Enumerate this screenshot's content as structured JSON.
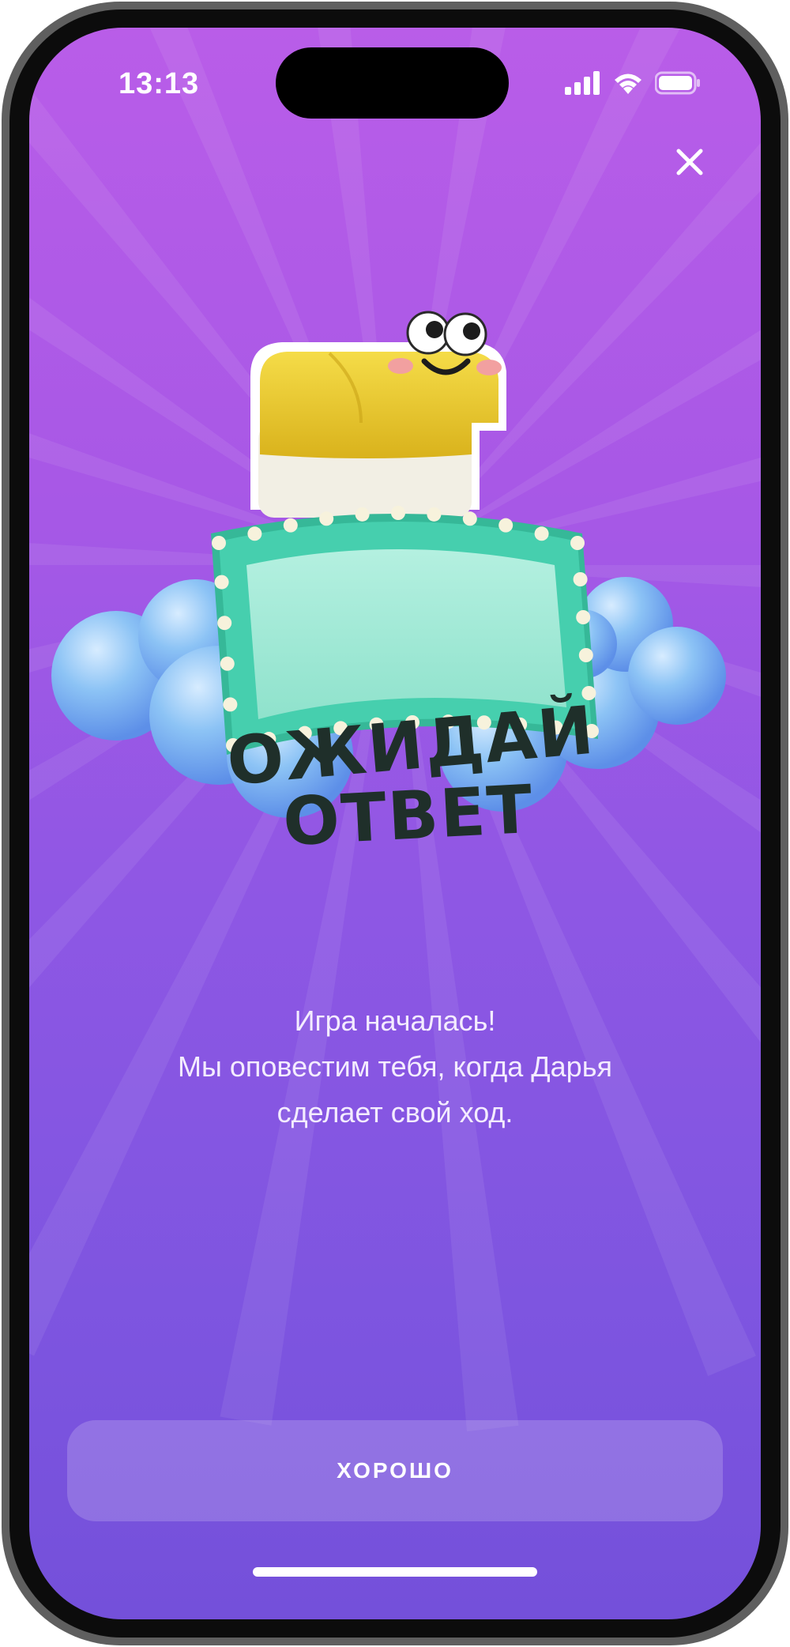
{
  "status_bar": {
    "time": "13:13",
    "icons": [
      "cellular-signal-icon",
      "wifi-icon",
      "battery-icon"
    ]
  },
  "close_icon": "close-icon",
  "illustration": {
    "sign_line1": "ОЖИДАЙ",
    "sign_line2": "ОТВЕТ",
    "mascot_icon": "scroll-mascot-icon"
  },
  "message": {
    "line1": "Игра началась!",
    "line2": "Мы оповестим тебя, когда Дарья",
    "line3": "сделает свой ход."
  },
  "button": {
    "label": "ХОРОШО"
  },
  "colors": {
    "background_top": "#b95de8",
    "background_bottom": "#7450da",
    "sign_frame": "#3fc3a6",
    "sign_panel": "#9be8d4",
    "mascot": "#e8c52a",
    "clouds": "#7fb8f2"
  }
}
